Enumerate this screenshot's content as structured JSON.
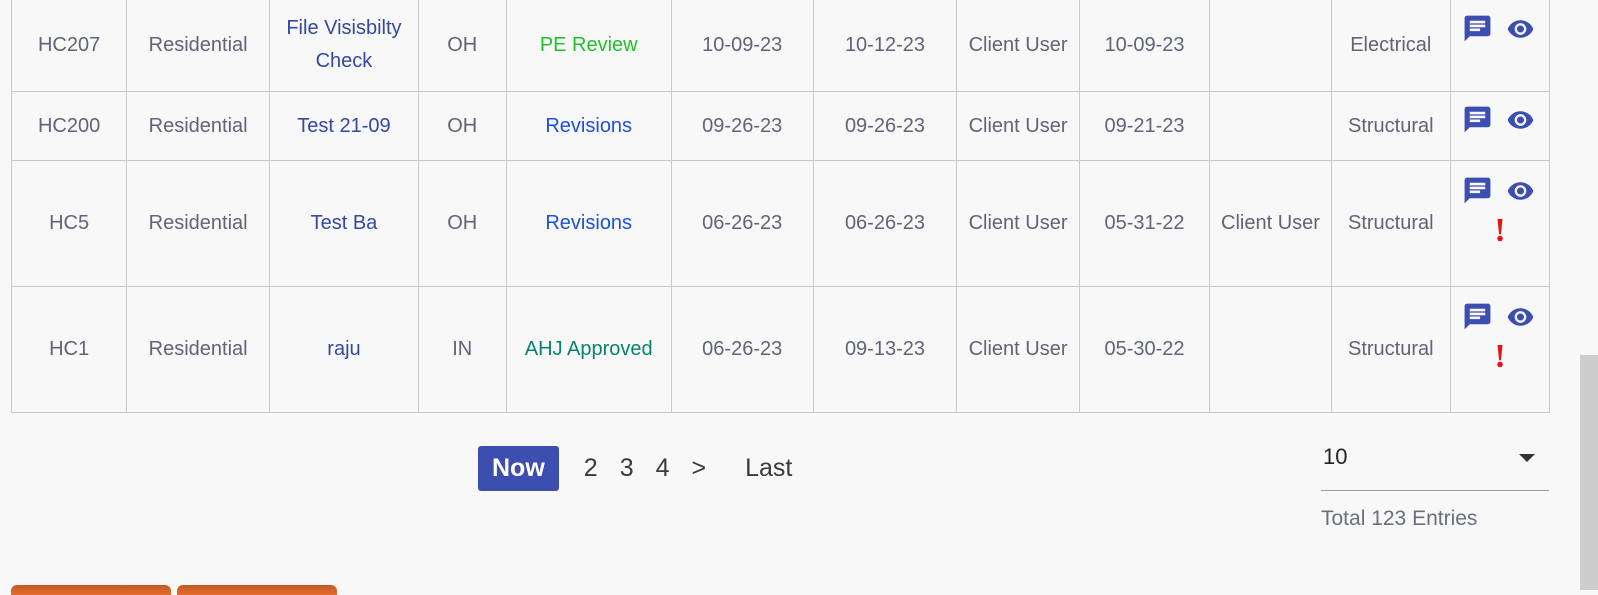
{
  "table": {
    "rows": [
      {
        "id": "HC207",
        "type": "Residential",
        "project": "File Visisbilty Check",
        "state": "OH",
        "status": "PE Review",
        "status_kind": "pe",
        "d1": "10-09-23",
        "d2": "10-12-23",
        "user": "Client User",
        "d3": "10-09-23",
        "assignee": "",
        "discipline": "Electrical",
        "alert": ""
      },
      {
        "id": "HC200",
        "type": "Residential",
        "project": "Test 21-09",
        "state": "OH",
        "status": "Revisions",
        "status_kind": "rev",
        "d1": "09-26-23",
        "d2": "09-26-23",
        "user": "Client User",
        "d3": "09-21-23",
        "assignee": "",
        "discipline": "Structural",
        "alert": ""
      },
      {
        "id": "HC5",
        "type": "Residential",
        "project": "Test Ba",
        "state": "OH",
        "status": "Revisions",
        "status_kind": "rev",
        "d1": "06-26-23",
        "d2": "06-26-23",
        "user": "Client User",
        "d3": "05-31-22",
        "assignee": "Client User",
        "discipline": "Structural",
        "alert": "!"
      },
      {
        "id": "HC1",
        "type": "Residential",
        "project": "raju",
        "state": "IN",
        "status": "AHJ Approved",
        "status_kind": "ahj",
        "d1": "06-26-23",
        "d2": "09-13-23",
        "user": "Client User",
        "d3": "05-30-22",
        "assignee": "",
        "discipline": "Structural",
        "alert": "!"
      }
    ],
    "icons": [
      "comment-icon",
      "eye-icon"
    ]
  },
  "pagination": {
    "current_label": "Now",
    "pages": [
      "2",
      "3",
      "4"
    ],
    "next_label": ">",
    "last_label": "Last"
  },
  "entries": {
    "page_size": "10",
    "total_label": "Total 123 Entries"
  },
  "colors": {
    "accent": "#3d4eb1",
    "pe_review": "#22c12b",
    "revisions": "#1b4fe0",
    "ahj_approved": "#08826e",
    "alert": "#e71414"
  }
}
